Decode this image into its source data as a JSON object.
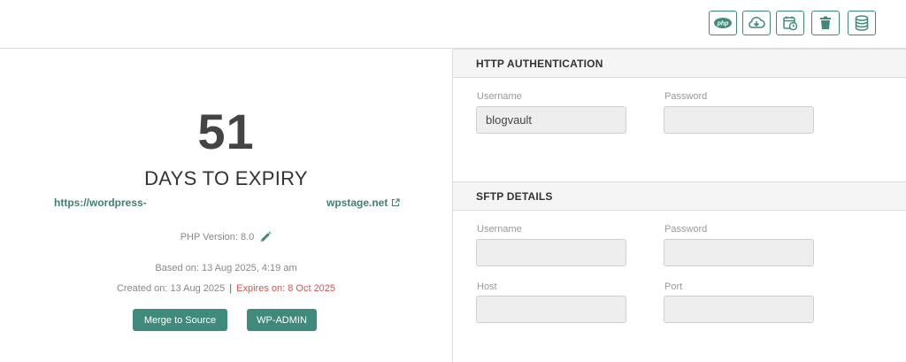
{
  "toolbar": {
    "buttons": [
      {
        "name": "php-button",
        "icon": "php-icon",
        "label": "php"
      },
      {
        "name": "cloud-download-button",
        "icon": "cloud-download-icon"
      },
      {
        "name": "schedule-button",
        "icon": "calendar-clock-icon"
      },
      {
        "name": "delete-button",
        "icon": "trash-icon"
      },
      {
        "name": "database-button",
        "icon": "database-icon"
      }
    ],
    "accent": "#3f8a7b"
  },
  "stage": {
    "days_count": "51",
    "days_label": "DAYS TO EXPIRY",
    "url_start": "https://wordpress-",
    "url_end": "wpstage.net",
    "php_version": "PHP Version: 8.0",
    "based_on": "Based on: 13 Aug 2025, 4:19 am",
    "created_on": "Created on: 13 Aug 2025",
    "separator": "|",
    "expires_on": "Expires on: 8 Oct 2025",
    "expires_color": "#d9534f",
    "merge_label": "Merge to Source",
    "wpadmin_label": "WP-ADMIN"
  },
  "http_auth": {
    "title": "HTTP AUTHENTICATION",
    "username_label": "Username",
    "username_value": "blogvault",
    "password_label": "Password",
    "password_value": ""
  },
  "sftp": {
    "title": "SFTP DETAILS",
    "username_label": "Username",
    "username_value": "",
    "password_label": "Password",
    "password_value": "",
    "host_label": "Host",
    "host_value": "",
    "port_label": "Port",
    "port_value": ""
  }
}
